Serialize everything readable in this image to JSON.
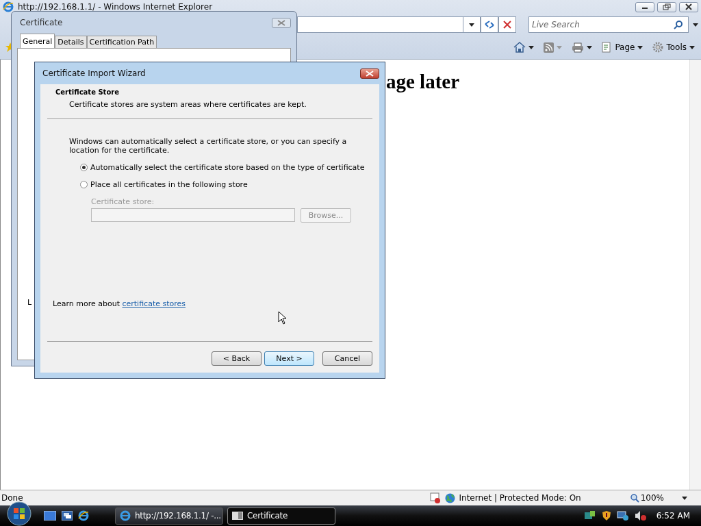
{
  "browser": {
    "title": "http://192.168.1.1/ - Windows Internet Explorer",
    "search": {
      "placeholder": "Live Search"
    },
    "toolbar": [
      {
        "kind": "home"
      },
      {
        "kind": "feeds"
      },
      {
        "kind": "print"
      },
      {
        "kind": "page",
        "label": "Page"
      },
      {
        "kind": "tools",
        "label": "Tools"
      }
    ],
    "heading": "age later",
    "status": {
      "text": "Done",
      "zone": "Internet | Protected Mode: On",
      "zoom": "100%"
    }
  },
  "certificate": {
    "title": "Certificate",
    "tabs": [
      {
        "label": "General",
        "selected": true
      },
      {
        "label": "Details",
        "selected": false
      },
      {
        "label": "Certification Path",
        "selected": false
      }
    ],
    "fragment": "L"
  },
  "wizard": {
    "title": "Certificate Import Wizard",
    "section_title": "Certificate Store",
    "section_subtitle": "Certificate stores are system areas where certificates are kept.",
    "intro": "Windows can automatically select a certificate store, or you can specify a location for the certificate.",
    "options": [
      {
        "label": "Automatically select the certificate store based on the type of certificate",
        "selected": true
      },
      {
        "label": "Place all certificates in the following store",
        "selected": false
      }
    ],
    "store": {
      "label": "Certificate store:",
      "disabled": true,
      "browse": "Browse..."
    },
    "learn_more": {
      "text": "Learn more about",
      "link": "certificate stores"
    },
    "buttons": [
      {
        "label": "< Back",
        "default": false
      },
      {
        "label": "Next >",
        "default": true
      },
      {
        "label": "Cancel",
        "default": false
      }
    ]
  },
  "taskbar": {
    "tasks": [
      {
        "kind": "ie",
        "label": "http://192.168.1.1/ -...",
        "selected": false
      },
      {
        "kind": "dialog",
        "label": "Certificate",
        "selected": true
      }
    ],
    "clock": "6:52 AM"
  }
}
